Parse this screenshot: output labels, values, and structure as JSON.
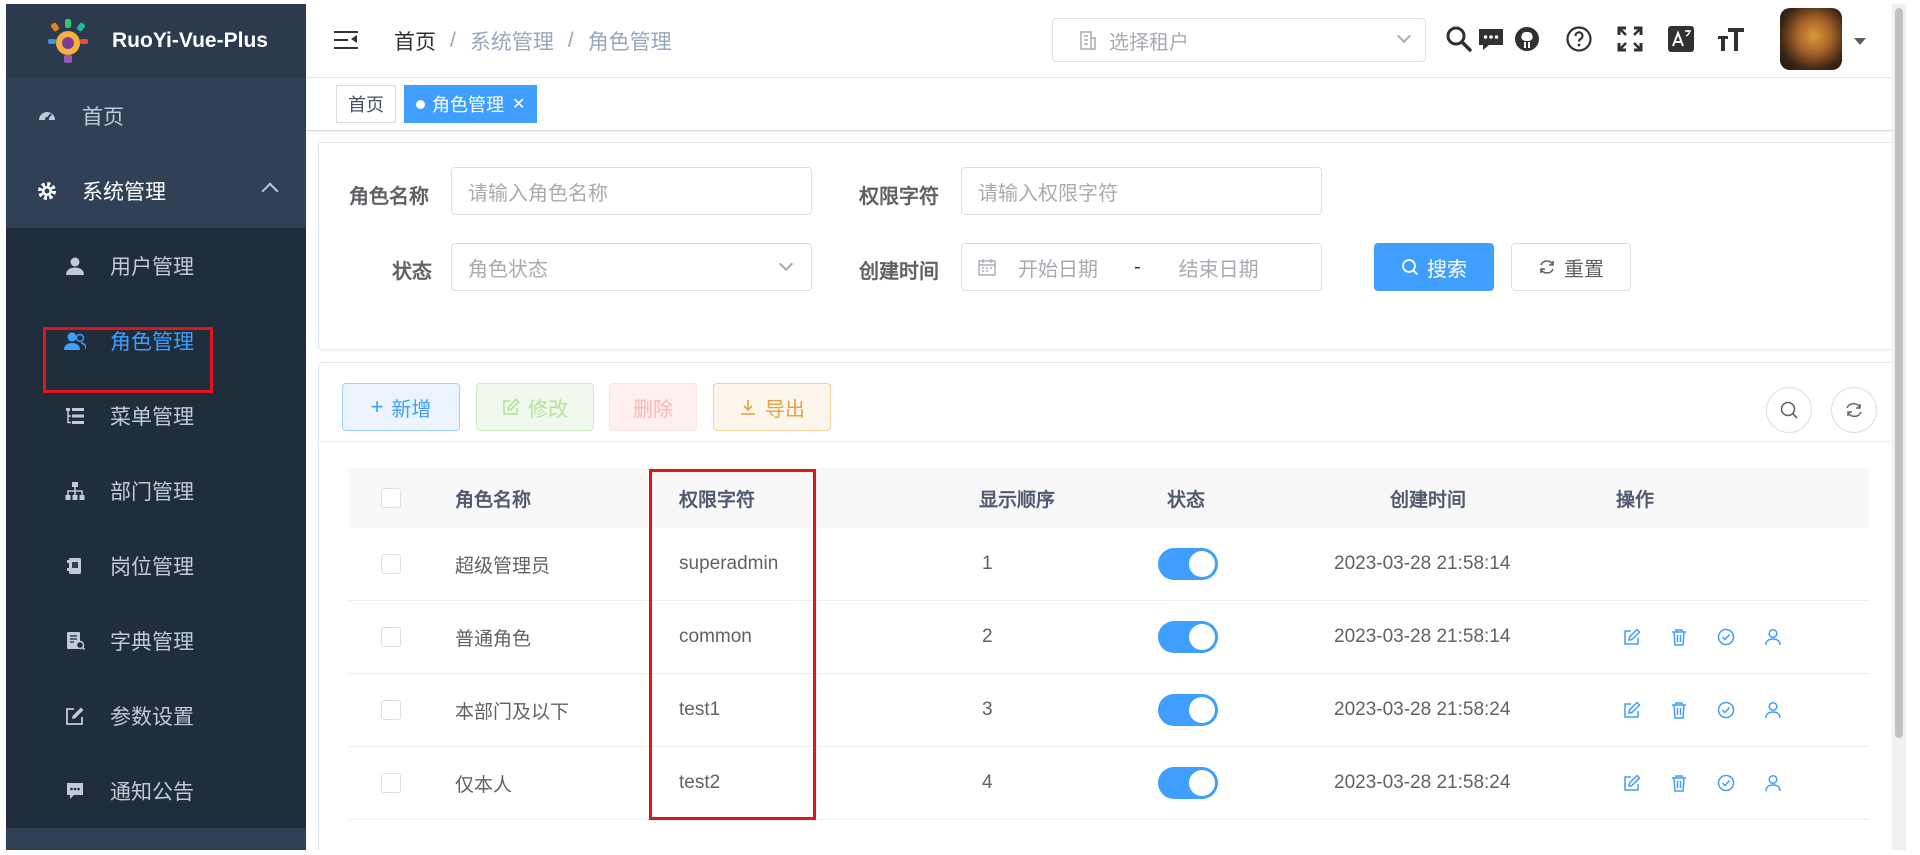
{
  "app": {
    "title": "RuoYi-Vue-Plus"
  },
  "sidebar": {
    "items": [
      {
        "label": "首页",
        "icon": "dashboard-icon"
      },
      {
        "label": "系统管理",
        "icon": "gear-icon"
      }
    ],
    "submenu": [
      {
        "label": "用户管理",
        "icon": "user-icon"
      },
      {
        "label": "角色管理",
        "icon": "peoples-icon"
      },
      {
        "label": "菜单管理",
        "icon": "tree-table-icon"
      },
      {
        "label": "部门管理",
        "icon": "org-tree-icon"
      },
      {
        "label": "岗位管理",
        "icon": "post-icon"
      },
      {
        "label": "字典管理",
        "icon": "dict-icon"
      },
      {
        "label": "参数设置",
        "icon": "edit-icon"
      },
      {
        "label": "通知公告",
        "icon": "message-icon"
      }
    ]
  },
  "header": {
    "breadcrumb": [
      "首页",
      "系统管理",
      "角色管理"
    ],
    "tenant_placeholder": "选择租户"
  },
  "tags": [
    {
      "label": "首页"
    },
    {
      "label": "角色管理"
    }
  ],
  "search": {
    "role_name_label": "角色名称",
    "role_name_placeholder": "请输入角色名称",
    "role_key_label": "权限字符",
    "role_key_placeholder": "请输入权限字符",
    "status_label": "状态",
    "status_placeholder": "角色状态",
    "created_label": "创建时间",
    "start_placeholder": "开始日期",
    "range_sep": "-",
    "end_placeholder": "结束日期",
    "search_btn": "搜索",
    "reset_btn": "重置"
  },
  "toolbar": {
    "add": "新增",
    "edit": "修改",
    "delete": "删除",
    "export": "导出"
  },
  "table": {
    "columns": [
      "角色名称",
      "权限字符",
      "显示顺序",
      "状态",
      "创建时间",
      "操作"
    ],
    "rows": [
      {
        "name": "超级管理员",
        "key": "superadmin",
        "order": "1",
        "enabled": true,
        "created": "2023-03-28 21:58:14",
        "actions": false
      },
      {
        "name": "普通角色",
        "key": "common",
        "order": "2",
        "enabled": true,
        "created": "2023-03-28 21:58:14",
        "actions": true
      },
      {
        "name": "本部门及以下",
        "key": "test1",
        "order": "3",
        "enabled": true,
        "created": "2023-03-28 21:58:24",
        "actions": true
      },
      {
        "name": "仅本人",
        "key": "test2",
        "order": "4",
        "enabled": true,
        "created": "2023-03-28 21:58:24",
        "actions": true
      }
    ]
  },
  "colors": {
    "sidebar_bg": "#304156",
    "primary": "#409eff",
    "highlight": "#e0161b"
  }
}
